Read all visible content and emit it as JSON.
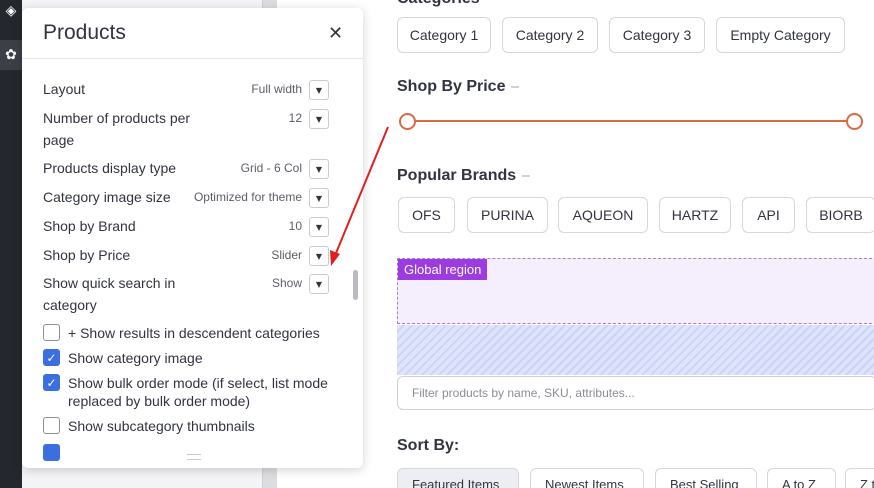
{
  "canvas": {
    "categories_title": "Categories",
    "categories": [
      "Category 1",
      "Category 2",
      "Category 3",
      "Empty Category"
    ],
    "shop_by_price_title": "Shop By Price",
    "price_slider_color": "#d96b44",
    "popular_brands_title": "Popular Brands",
    "brands": [
      "OFS",
      "PURINA",
      "AQUEON",
      "HARTZ",
      "API",
      "BIORB"
    ],
    "global_region_label": "Global region",
    "global_region_color": "#9b3be0",
    "filter_placeholder": "Filter products by name, SKU, attributes...",
    "sort_title": "Sort By:",
    "sort_options": [
      "Featured Items",
      "Newest Items",
      "Best Selling",
      "A to Z",
      "Z t"
    ]
  },
  "panel": {
    "title": "Products",
    "settings": [
      {
        "label": "Layout",
        "value": "Full width"
      },
      {
        "label": "Number of products per page",
        "value": "12"
      },
      {
        "label": "Products display type",
        "value": "Grid - 6 Col"
      },
      {
        "label": "Category image size",
        "value": "Optimized for theme"
      },
      {
        "label": "Shop by Brand",
        "value": "10"
      },
      {
        "label": "Shop by Price",
        "value": "Slider"
      },
      {
        "label": "Show quick search in category",
        "value": "Show"
      }
    ],
    "checkboxes": [
      {
        "label": "+ Show results in descendent categories",
        "checked": false
      },
      {
        "label": "Show category image",
        "checked": true
      },
      {
        "label": "Show bulk order mode (if select, list mode replaced by bulk order mode)",
        "checked": true
      },
      {
        "label": "Show subcategory thumbnails",
        "checked": false
      }
    ],
    "checkbox_color": "#3b6fe0"
  },
  "annotation": {
    "arrow_color": "#e02020"
  }
}
